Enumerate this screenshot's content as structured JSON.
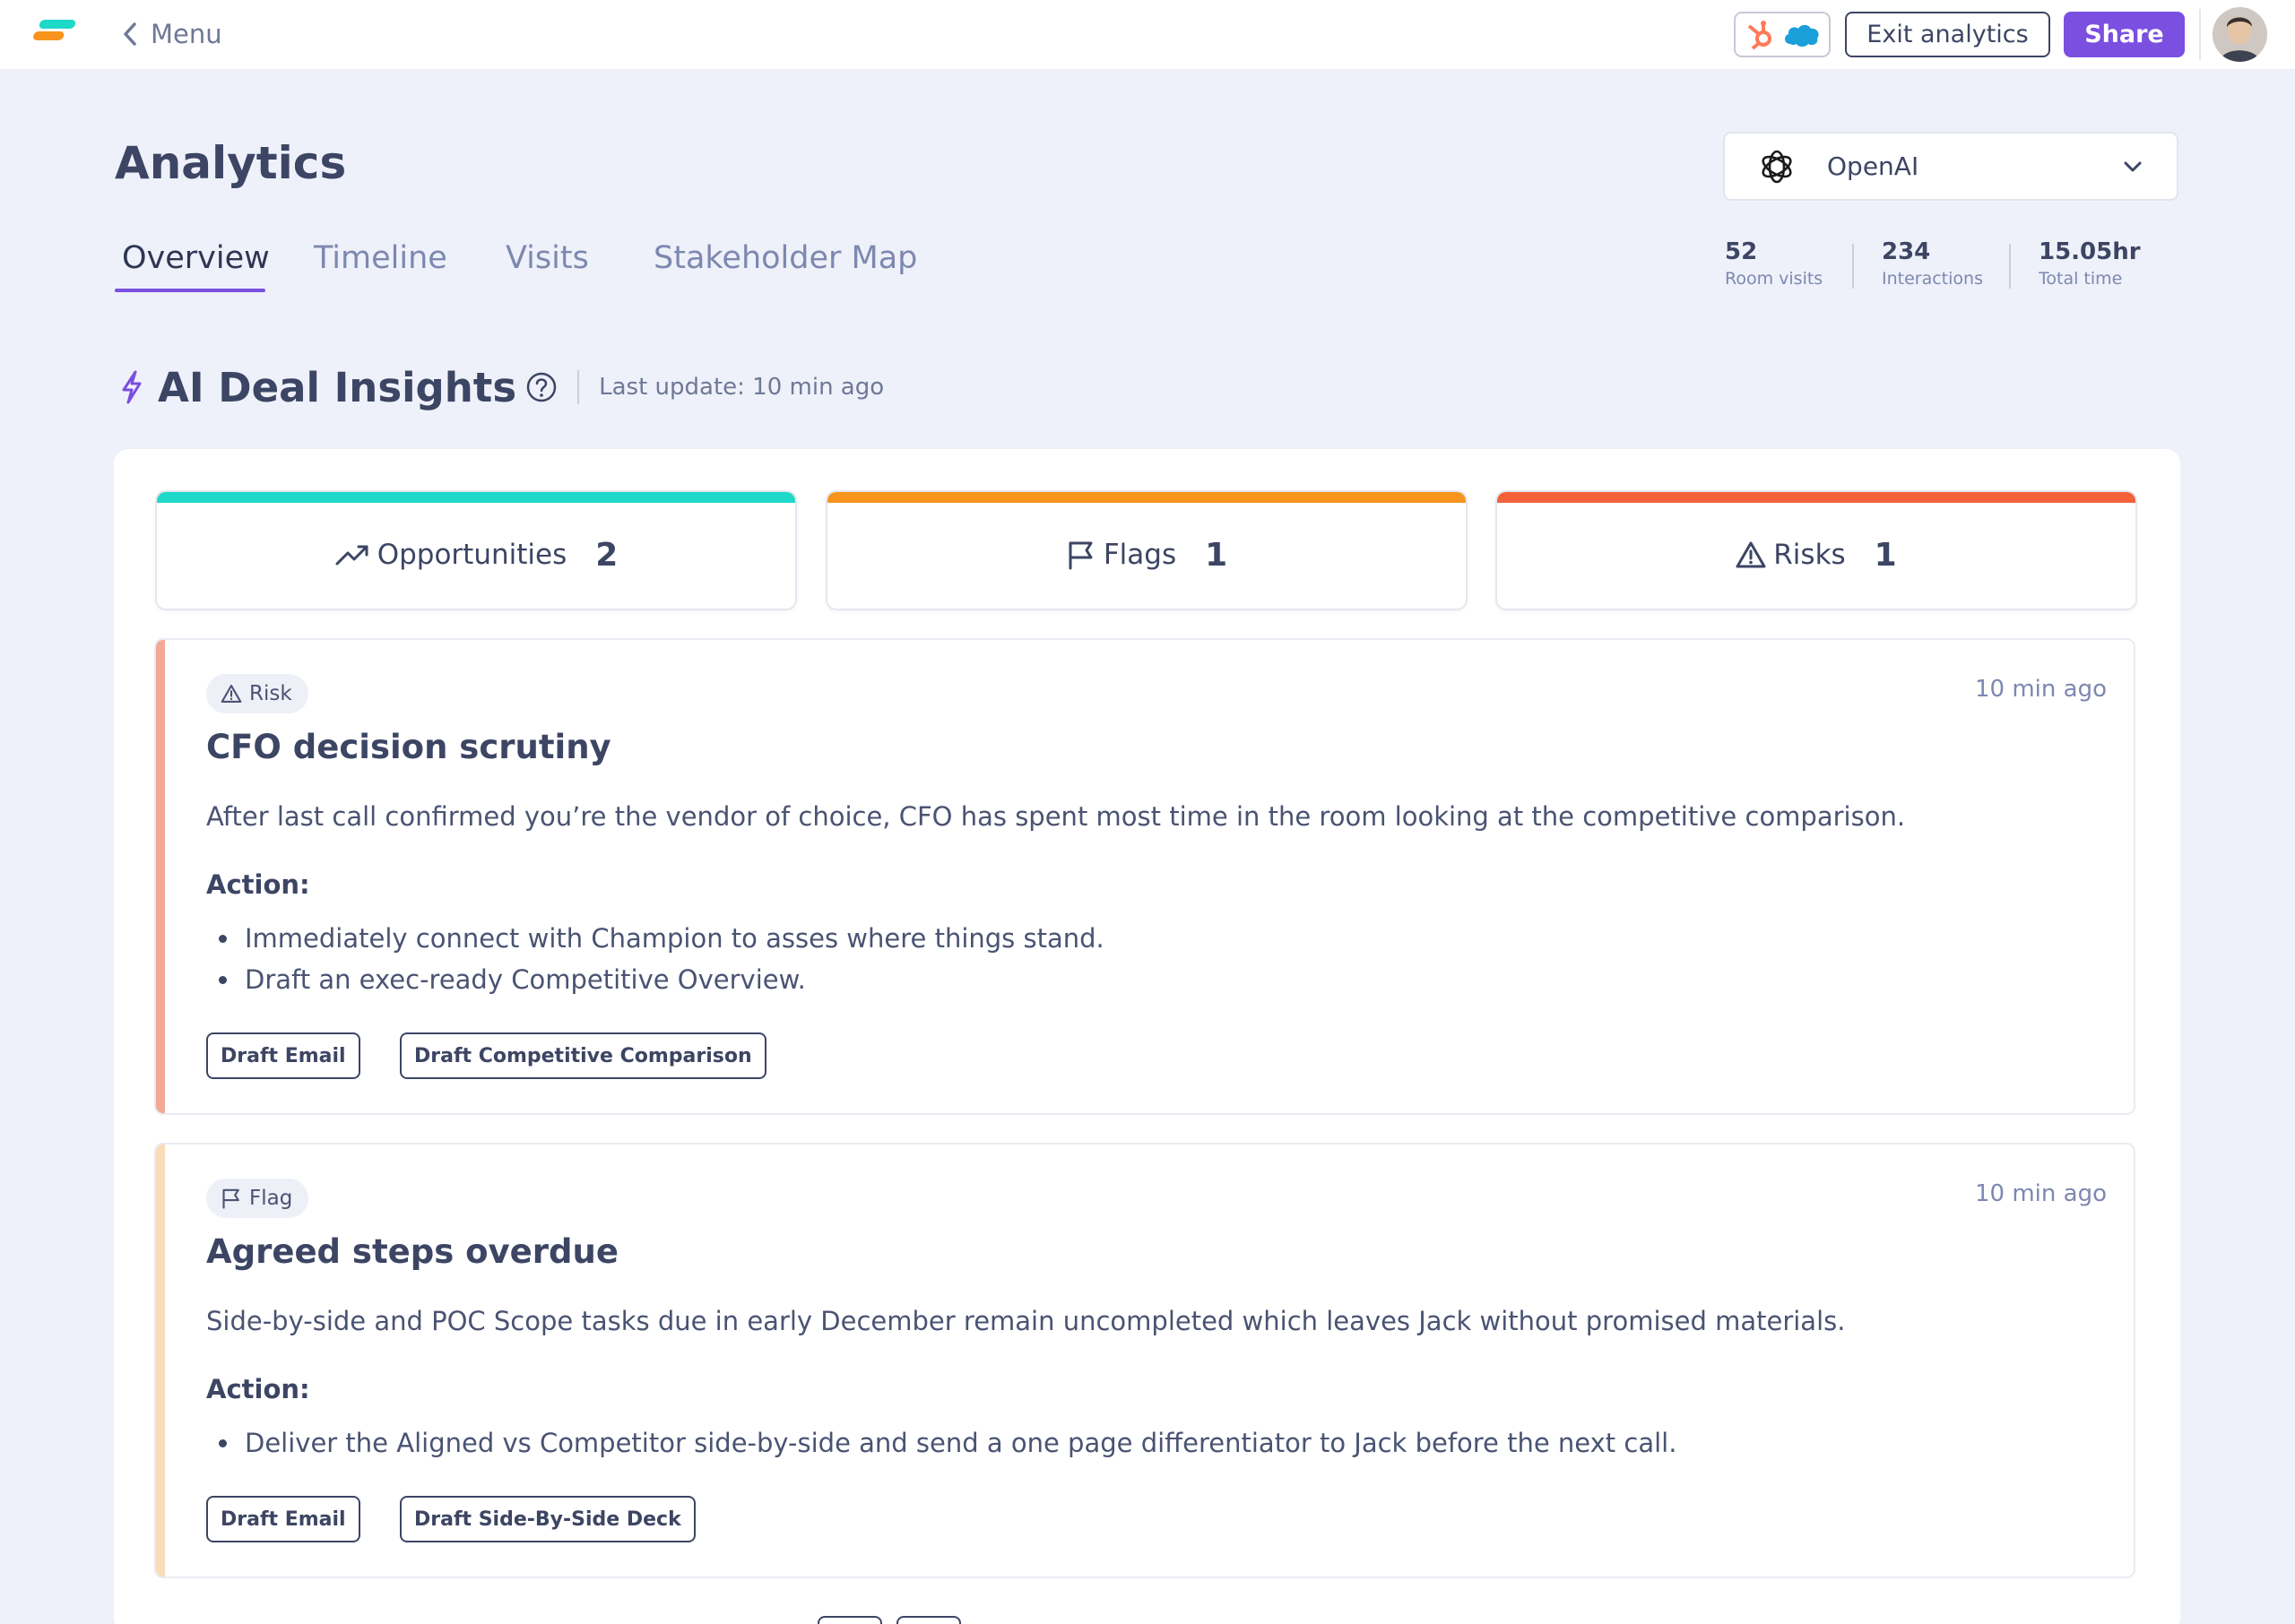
{
  "topbar": {
    "menu_label": "Menu",
    "exit_label": "Exit analytics",
    "share_label": "Share",
    "integration_icons": [
      "hubspot-icon",
      "salesforce-icon"
    ],
    "brand_color": "#7b4fe0"
  },
  "header": {
    "title": "Analytics",
    "company": {
      "name": "OpenAI",
      "icon": "openai-icon"
    },
    "tabs": [
      {
        "label": "Overview",
        "active": true
      },
      {
        "label": "Timeline",
        "active": false
      },
      {
        "label": "Visits",
        "active": false
      },
      {
        "label": "Stakeholder Map",
        "active": false
      }
    ],
    "stats": [
      {
        "value": "52",
        "label": "Room visits"
      },
      {
        "value": "234",
        "label": "Interactions"
      },
      {
        "value": "15.05hr",
        "label": "Total time"
      }
    ]
  },
  "insights": {
    "title": "AI Deal Insights",
    "last_update": "Last update: 10 min ago",
    "summary": [
      {
        "label": "Opportunities",
        "count": "2",
        "color": "#1ed8c8",
        "icon": "trending-up-icon"
      },
      {
        "label": "Flags",
        "count": "1",
        "color": "#f7941d",
        "icon": "flag-icon"
      },
      {
        "label": "Risks",
        "count": "1",
        "color": "#f2613a",
        "icon": "warning-icon"
      }
    ],
    "items": [
      {
        "type": "Risk",
        "time": "10 min ago",
        "title": "CFO decision scrutiny",
        "description": "After last call confirmed  you’re the vendor of choice, CFO has spent most time in the room looking at the competitive comparison.",
        "action_label": "Action:",
        "actions": [
          "Immediately connect with Champion to asses where things stand.",
          "Draft an exec-ready Competitive Overview."
        ],
        "buttons": [
          "Draft Email",
          "Draft Competitive Comparison"
        ],
        "stripe_color": "#f4a898"
      },
      {
        "type": "Flag",
        "time": "10 min ago",
        "title": "Agreed steps overdue",
        "description": "Side-by-side and POC Scope tasks due in early December remain uncompleted which leaves Jack without promised materials.",
        "action_label": "Action:",
        "actions": [
          "Deliver the Aligned vs Competitor side-by-side and send a one page differentiator to Jack before the next call."
        ],
        "buttons": [
          "Draft Email",
          "Draft Side-By-Side Deck"
        ],
        "stripe_color": "#fbdcb8"
      }
    ]
  }
}
